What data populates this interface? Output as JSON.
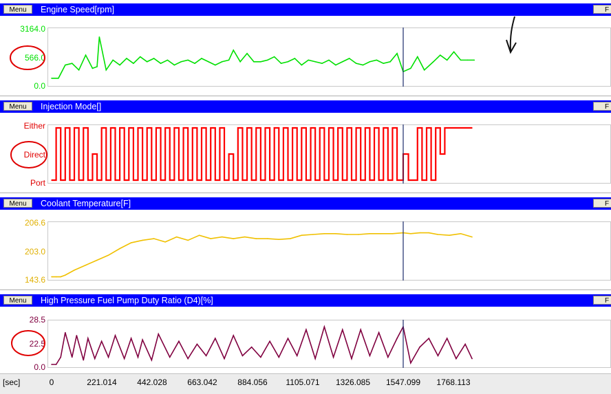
{
  "panels": [
    {
      "menu_label": "Menu",
      "f_label": "F",
      "title": "Engine Speed[rpm]",
      "color": "#00e000",
      "y_ticks": [
        "3164.0",
        "566.0",
        "0.0"
      ],
      "y_tick_values": [
        3164,
        566,
        0
      ],
      "annotated_tick": "566.0"
    },
    {
      "menu_label": "Menu",
      "f_label": "F",
      "title": "Injection Mode[]",
      "color": "#ff0000",
      "y_ticks": [
        "Either",
        "Direct",
        "Port"
      ],
      "y_tick_values": [
        2,
        1,
        0
      ],
      "annotated_tick": "Direct"
    },
    {
      "menu_label": "Menu",
      "f_label": "F",
      "title": "Coolant Temperature[F]",
      "color": "#f0c000",
      "y_ticks": [
        "206.6",
        "203.0",
        "143.6"
      ],
      "y_tick_values": [
        206.6,
        203.0,
        143.6
      ],
      "annotated_tick": ""
    },
    {
      "menu_label": "Menu",
      "f_label": "F",
      "title": "High Pressure Fuel Pump Duty Ratio (D4)[%]",
      "color": "#800040",
      "y_ticks": [
        "28.5",
        "22.5",
        "0.0"
      ],
      "y_tick_values": [
        28.5,
        22.5,
        0
      ],
      "annotated_tick": "22.5"
    }
  ],
  "x_axis": {
    "unit": "[sec]",
    "ticks": [
      "0",
      "221.014",
      "442.028",
      "663.042",
      "884.056",
      "1105.071",
      "1326.085",
      "1547.099",
      "1768.113"
    ]
  },
  "cursor_time": 1547.099,
  "annotation_color": "#e00000",
  "chart_data": [
    {
      "type": "line",
      "title": "Engine Speed[rpm]",
      "xlabel": "[sec]",
      "ylim": [
        0,
        3164
      ],
      "x": [
        0,
        30,
        60,
        90,
        120,
        150,
        180,
        200,
        210,
        240,
        270,
        300,
        330,
        360,
        390,
        420,
        450,
        480,
        510,
        540,
        570,
        600,
        630,
        660,
        690,
        720,
        750,
        780,
        800,
        830,
        860,
        890,
        920,
        950,
        980,
        1010,
        1040,
        1070,
        1100,
        1130,
        1160,
        1190,
        1220,
        1250,
        1280,
        1310,
        1340,
        1370,
        1400,
        1430,
        1460,
        1490,
        1520,
        1547,
        1580,
        1610,
        1640,
        1680,
        1710,
        1740,
        1770,
        1800,
        1830,
        1860
      ],
      "series": [
        {
          "values": [
            300,
            300,
            1100,
            1200,
            800,
            1700,
            900,
            1000,
            2800,
            800,
            1400,
            1100,
            1500,
            1200,
            1600,
            1300,
            1500,
            1200,
            1400,
            1100,
            1300,
            1400,
            1200,
            1500,
            1300,
            1100,
            1300,
            1400,
            2000,
            1300,
            1800,
            1300,
            1300,
            1400,
            1600,
            1200,
            1300,
            1500,
            1100,
            1400,
            1300,
            1200,
            1400,
            1100,
            1300,
            1500,
            1200,
            1100,
            1300,
            1400,
            1200,
            1300,
            1800,
            700,
            900,
            1600,
            800,
            1300,
            1700,
            1400,
            1900,
            1400,
            1400,
            1400
          ]
        }
      ]
    },
    {
      "type": "line",
      "title": "Injection Mode[]",
      "xlabel": "[sec]",
      "y_categories": [
        "Port",
        "Direct",
        "Either"
      ],
      "x": [
        0,
        20,
        40,
        60,
        80,
        100,
        120,
        140,
        160,
        180,
        200,
        220,
        240,
        260,
        280,
        300,
        320,
        340,
        360,
        380,
        400,
        420,
        440,
        460,
        480,
        500,
        520,
        540,
        560,
        580,
        600,
        620,
        640,
        660,
        680,
        700,
        720,
        740,
        760,
        780,
        800,
        820,
        840,
        860,
        880,
        900,
        920,
        940,
        960,
        980,
        1000,
        1020,
        1040,
        1060,
        1080,
        1100,
        1120,
        1140,
        1160,
        1180,
        1200,
        1220,
        1240,
        1260,
        1280,
        1300,
        1320,
        1340,
        1360,
        1380,
        1400,
        1420,
        1440,
        1460,
        1480,
        1500,
        1520,
        1547,
        1570,
        1590,
        1610,
        1630,
        1650,
        1670,
        1690,
        1710,
        1730,
        1750,
        1770,
        1790,
        1810,
        1830,
        1850
      ],
      "series": [
        {
          "values": [
            0,
            2,
            0,
            2,
            0,
            2,
            0,
            2,
            0,
            1,
            0,
            2,
            0,
            2,
            0,
            2,
            0,
            2,
            0,
            2,
            0,
            2,
            0,
            2,
            0,
            2,
            0,
            2,
            0,
            2,
            0,
            2,
            0,
            2,
            0,
            2,
            0,
            2,
            0,
            1,
            0,
            2,
            0,
            2,
            0,
            2,
            0,
            2,
            0,
            2,
            0,
            2,
            0,
            2,
            0,
            2,
            0,
            2,
            0,
            2,
            0,
            2,
            0,
            2,
            0,
            2,
            0,
            2,
            0,
            2,
            0,
            2,
            0,
            2,
            0,
            2,
            0,
            1,
            0,
            0,
            2,
            0,
            2,
            0,
            2,
            1,
            2,
            2,
            2,
            2,
            2,
            2,
            2
          ]
        }
      ]
    },
    {
      "type": "line",
      "title": "Coolant Temperature[F]",
      "xlabel": "[sec]",
      "ylim": [
        143.6,
        206.6
      ],
      "x": [
        0,
        20,
        40,
        60,
        100,
        150,
        200,
        250,
        300,
        350,
        400,
        450,
        500,
        550,
        600,
        650,
        700,
        750,
        800,
        850,
        900,
        950,
        1000,
        1050,
        1100,
        1150,
        1200,
        1250,
        1300,
        1350,
        1400,
        1450,
        1500,
        1547,
        1580,
        1620,
        1660,
        1700,
        1750,
        1800,
        1850
      ],
      "series": [
        {
          "values": [
            144,
            144,
            144,
            146,
            152,
            158,
            164,
            170,
            178,
            185,
            188,
            190,
            186,
            192,
            188,
            194,
            190,
            192,
            190,
            192,
            190,
            190,
            189,
            190,
            194,
            195,
            196,
            196,
            195,
            195,
            196,
            196,
            196,
            197,
            196,
            197,
            197,
            195,
            194,
            196,
            192
          ]
        }
      ]
    },
    {
      "type": "line",
      "title": "High Pressure Fuel Pump Duty Ratio (D4)[%]",
      "xlabel": "[sec]",
      "ylim": [
        0,
        28.5
      ],
      "x": [
        0,
        20,
        40,
        60,
        90,
        110,
        140,
        160,
        190,
        220,
        250,
        280,
        320,
        350,
        380,
        400,
        440,
        470,
        520,
        560,
        600,
        640,
        680,
        720,
        760,
        800,
        840,
        880,
        920,
        960,
        1000,
        1040,
        1080,
        1120,
        1160,
        1200,
        1240,
        1280,
        1320,
        1360,
        1400,
        1440,
        1480,
        1520,
        1547,
        1580,
        1620,
        1660,
        1700,
        1740,
        1780,
        1820,
        1850
      ],
      "series": [
        {
          "values": [
            0,
            0,
            5,
            22,
            5,
            20,
            3,
            18,
            4,
            16,
            5,
            20,
            4,
            18,
            5,
            17,
            3,
            21,
            5,
            16,
            4,
            14,
            6,
            18,
            4,
            20,
            6,
            12,
            5,
            16,
            5,
            18,
            6,
            24,
            4,
            26,
            5,
            24,
            4,
            24,
            6,
            22,
            5,
            18,
            26,
            1,
            12,
            18,
            6,
            18,
            4,
            14,
            4
          ]
        }
      ]
    }
  ]
}
